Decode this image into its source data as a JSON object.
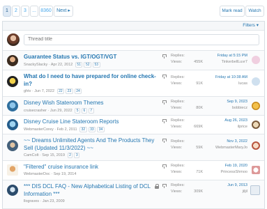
{
  "pagination": {
    "pages": [
      "1",
      "2",
      "3",
      "...",
      "8360"
    ],
    "next_label": "Next ▸"
  },
  "actions": {
    "mark_read": "Mark read",
    "watch": "Watch"
  },
  "filter_bar": {
    "filters_label": "Filters ▾"
  },
  "new_thread": {
    "placeholder": "Thread title"
  },
  "threads": [
    {
      "title": "Guarantee Status vs. IGT/OGT/VGT",
      "author": "SnackySlacky",
      "date": "Apr 22, 2012",
      "pages": [
        "51",
        "52",
        "53"
      ],
      "replies": "",
      "views": "455K",
      "last_date": "Friday at 5:15 PM",
      "last_user": "TinkerbellLuvr7",
      "pinned": true,
      "locked": false,
      "bold": true
    },
    {
      "title": "What do I need to have prepared for online check-in?",
      "author": "ghtv",
      "date": "Jun 7, 2022",
      "pages": [
        "22",
        "23",
        "24"
      ],
      "replies": "",
      "views": "91K",
      "last_date": "Friday at 10:38 AM",
      "last_user": "lucas",
      "pinned": true,
      "locked": false,
      "bold": true
    },
    {
      "title": "Disney Wish Stateroom Themes",
      "author": "cruisecrasher",
      "date": "Jun 29, 2022",
      "pages": [
        "5",
        "6",
        "7"
      ],
      "replies": "",
      "views": "80K",
      "last_date": "Sep 9, 2023",
      "last_user": "bobbiecz",
      "pinned": true,
      "locked": false,
      "bold": false
    },
    {
      "title": "Disney Cruise Line Stateroom Reports",
      "author": "WebmasterCorey",
      "date": "Feb 2, 2011",
      "pages": [
        "32",
        "33",
        "34"
      ],
      "replies": "",
      "views": "669K",
      "last_date": "Aug 26, 2023",
      "last_user": "ilprice",
      "pinned": true,
      "locked": false,
      "bold": false
    },
    {
      "title": "~~ Dreams Unlimited Agents And The Products They Sell (Updated 11/3/2022) ~~",
      "author": "CamColt",
      "date": "Sep 15, 2019",
      "pages": [
        "2",
        "3"
      ],
      "replies": "",
      "views": "59K",
      "last_date": "Nov 3, 2022",
      "last_user": "WebmasterMaryJo",
      "pinned": true,
      "locked": false,
      "bold": false
    },
    {
      "title": "\"Filtered\" cruise insurance link",
      "author": "WebmasterDoc",
      "date": "Sep 19, 2014",
      "pages": [],
      "replies": "",
      "views": "71K",
      "last_date": "Feb 19, 2020",
      "last_user": "PrincessShmoo",
      "pinned": true,
      "locked": false,
      "bold": false
    },
    {
      "title": "*** DIS DCL FAQ - New Alphabetical Listing of DCL Information ***",
      "author": "llograves",
      "date": "Jan 23, 2009",
      "pages": [],
      "replies": "",
      "views": "309K",
      "last_date": "Jun 9, 2013",
      "last_user": "jiljil",
      "pinned": true,
      "locked": true,
      "bold": false
    }
  ],
  "labels": {
    "replies": "Replies:",
    "views": "Views:"
  },
  "colors": {
    "link": "#2577b1",
    "muted": "#8c8c8c",
    "border": "#d8dee4",
    "accent_bg": "#dfeaf5"
  }
}
